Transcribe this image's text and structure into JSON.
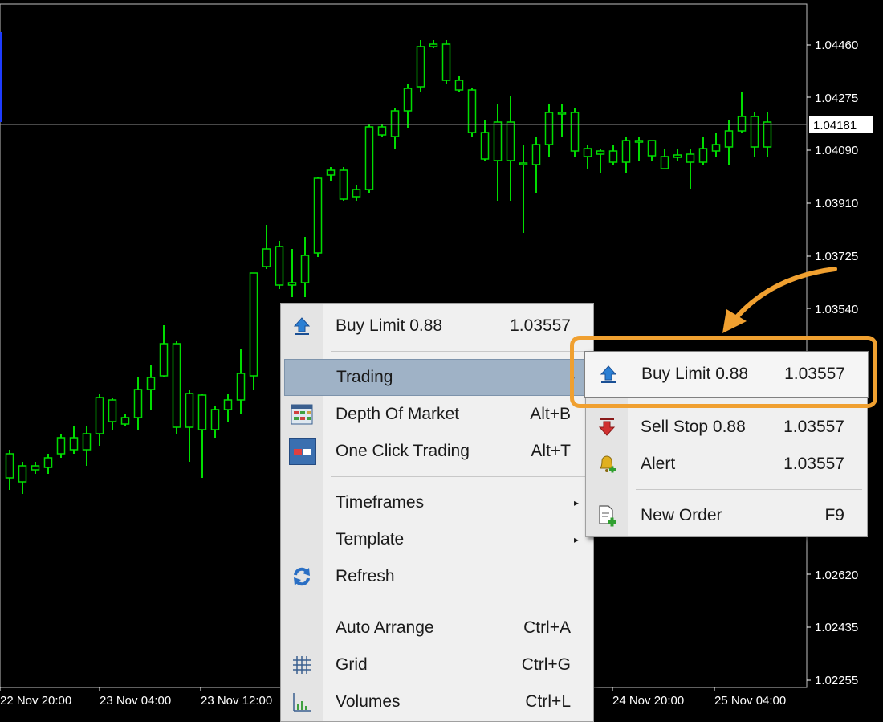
{
  "price_axis": {
    "labels": [
      "1.04460",
      "1.04275",
      "1.04090",
      "1.03910",
      "1.03725",
      "1.03540",
      "1.02620",
      "1.02435",
      "1.02255"
    ],
    "current_price": "1.04181"
  },
  "time_axis": {
    "labels": [
      "22 Nov 20:00",
      "23 Nov 04:00",
      "23 Nov 12:00",
      "24 Nov 20:00",
      "25 Nov 04:00"
    ]
  },
  "context_menu": {
    "items": [
      {
        "label": "Buy Limit 0.88",
        "shortcut": "1.03557",
        "icon": "buy-limit-icon"
      },
      {
        "label": "Trading",
        "shortcut": "",
        "icon": ""
      },
      {
        "label": "Depth Of Market",
        "shortcut": "Alt+B",
        "icon": "depth-of-market-icon"
      },
      {
        "label": "One Click Trading",
        "shortcut": "Alt+T",
        "icon": "one-click-trading-icon"
      },
      {
        "label": "Timeframes",
        "shortcut": "",
        "icon": ""
      },
      {
        "label": "Template",
        "shortcut": "",
        "icon": ""
      },
      {
        "label": "Refresh",
        "shortcut": "",
        "icon": "refresh-icon"
      },
      {
        "label": "Auto Arrange",
        "shortcut": "Ctrl+A",
        "icon": ""
      },
      {
        "label": "Grid",
        "shortcut": "Ctrl+G",
        "icon": "grid-icon"
      },
      {
        "label": "Volumes",
        "shortcut": "Ctrl+L",
        "icon": "volumes-icon"
      }
    ]
  },
  "trading_submenu": {
    "items": [
      {
        "label": "Buy Limit 0.88",
        "shortcut": "1.03557",
        "icon": "buy-limit-icon"
      },
      {
        "label": "Sell Stop 0.88",
        "shortcut": "1.03557",
        "icon": "sell-stop-icon"
      },
      {
        "label": "Alert",
        "shortcut": "1.03557",
        "icon": "alert-bell-icon"
      },
      {
        "label": "New Order",
        "shortcut": "F9",
        "icon": "new-order-icon"
      }
    ]
  },
  "colors": {
    "background": "#000000",
    "bull_candle": "#ffffff",
    "bear_candle": "#000000",
    "wick": "#00dd00",
    "price_line": "#909090",
    "highlight": "#f0a030"
  }
}
